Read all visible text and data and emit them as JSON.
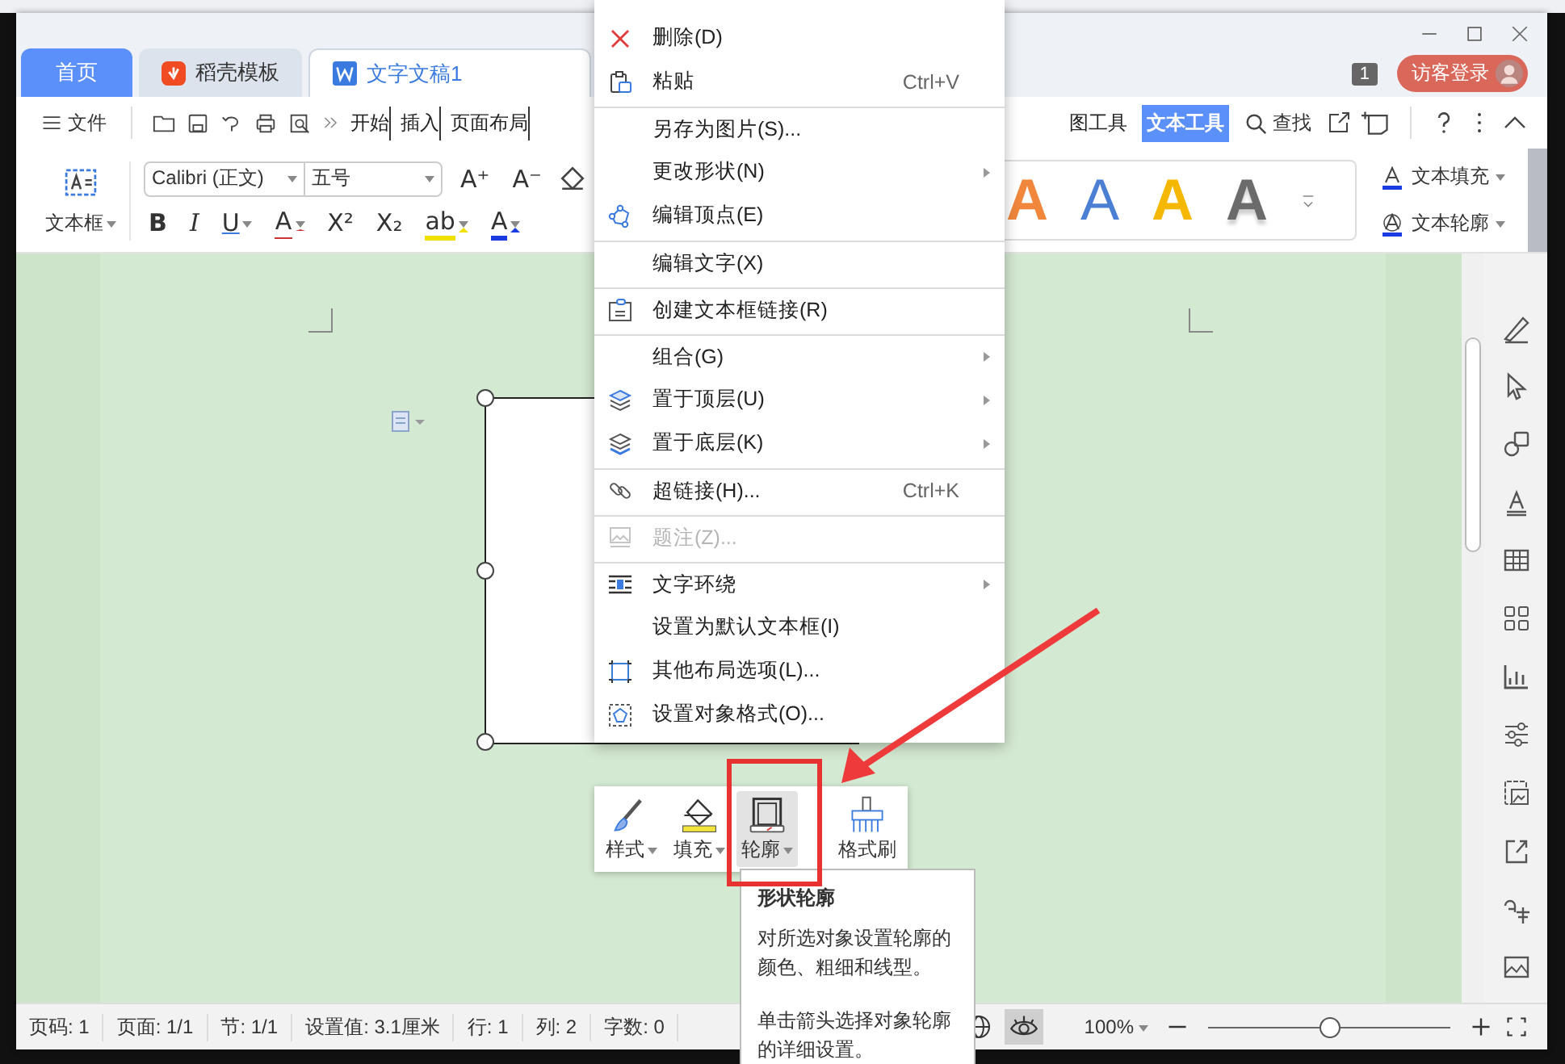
{
  "tabs": [
    {
      "label": "首页",
      "kind": "home",
      "selected": false
    },
    {
      "label": "稻壳模板",
      "kind": "docer",
      "selected": false
    },
    {
      "label": "文字文稿1",
      "kind": "document",
      "selected": true
    }
  ],
  "notification_count": "1",
  "login_button": "访客登录",
  "menu_bar": {
    "file": "文件",
    "ribbon_tabs": [
      {
        "label": "开始",
        "selected": false
      },
      {
        "label": "插入",
        "selected": false
      },
      {
        "label": "页面布局",
        "selected": false
      }
    ],
    "context_tabs": [
      {
        "label": "图工具",
        "selected": false
      },
      {
        "label": "文本工具",
        "selected": true
      }
    ],
    "search": "查找"
  },
  "ribbon": {
    "textbox": "文本框",
    "font": "Calibri (正文)",
    "font_size": "五号",
    "grow_font": "A⁺",
    "shrink_font": "A⁻",
    "format_buttons": [
      {
        "label": "B",
        "kind": "bold"
      },
      {
        "label": "I",
        "kind": "italic"
      },
      {
        "label": "U",
        "kind": "underline"
      },
      {
        "label": "A",
        "kind": "strike"
      },
      {
        "label": "X²",
        "kind": "plain"
      },
      {
        "label": "X₂",
        "kind": "plain"
      },
      {
        "label": "ab",
        "kind": "highlight"
      },
      {
        "label": "A",
        "kind": "font-color"
      }
    ],
    "art_styles": [
      {
        "label": "A",
        "color": "#f0873c",
        "kind": "filled"
      },
      {
        "label": "A",
        "color": "#4a7fd4",
        "kind": "outline"
      },
      {
        "label": "A",
        "color": "#f5b800",
        "kind": "filled"
      },
      {
        "label": "A",
        "color": "#6b6b6b",
        "kind": "gradient"
      }
    ],
    "text_fill": "文本填充",
    "text_outline": "文本轮廓"
  },
  "context_menu": {
    "items": [
      {
        "label": "删除(D)",
        "kind": "cross",
        "divider_before": false,
        "submenu": false,
        "disabled": false
      },
      {
        "label": "粘贴",
        "shortcut": "Ctrl+V",
        "kind": "clipboard",
        "divider_before": false,
        "submenu": false,
        "disabled": false
      },
      {
        "label": "另存为图片(S)...",
        "divider_before": true,
        "submenu": false,
        "disabled": false
      },
      {
        "label": "更改形状(N)",
        "divider_before": false,
        "submenu": true,
        "disabled": false
      },
      {
        "label": "编辑顶点(E)",
        "kind": "nodes",
        "divider_before": false,
        "submenu": false,
        "disabled": false
      },
      {
        "label": "编辑文字(X)",
        "divider_before": true,
        "submenu": false,
        "disabled": false
      },
      {
        "label": "创建文本框链接(R)",
        "kind": "linked-textbox",
        "divider_before": true,
        "submenu": false,
        "disabled": false
      },
      {
        "label": "组合(G)",
        "divider_before": true,
        "submenu": true,
        "disabled": false
      },
      {
        "label": "置于顶层(U)",
        "kind": "layers-top",
        "divider_before": false,
        "submenu": true,
        "disabled": false
      },
      {
        "label": "置于底层(K)",
        "kind": "layers-bottom",
        "divider_before": false,
        "submenu": true,
        "disabled": false
      },
      {
        "label": "超链接(H)...",
        "shortcut": "Ctrl+K",
        "kind": "chain",
        "divider_before": true,
        "submenu": false,
        "disabled": false
      },
      {
        "label": "题注(Z)...",
        "kind": "caption",
        "divider_before": true,
        "submenu": false,
        "disabled": true
      },
      {
        "label": "文字环绕",
        "kind": "wrap",
        "divider_before": true,
        "submenu": true,
        "disabled": false
      },
      {
        "label": "设置为默认文本框(I)",
        "divider_before": false,
        "submenu": false,
        "disabled": false
      },
      {
        "label": "其他布局选项(L)...",
        "kind": "frame",
        "divider_before": false,
        "submenu": false,
        "disabled": false
      },
      {
        "label": "设置对象格式(O)...",
        "kind": "format",
        "divider_before": false,
        "submenu": false,
        "disabled": false
      }
    ]
  },
  "float_toolbar": [
    {
      "label": "样式",
      "kind": "brush",
      "has_caret": true,
      "selected": false
    },
    {
      "label": "填充",
      "kind": "fill",
      "has_caret": true,
      "selected": false
    },
    {
      "label": "轮廓",
      "kind": "outline",
      "has_caret": true,
      "selected": true
    },
    {
      "label": "格式刷",
      "kind": "painter",
      "has_caret": false,
      "selected": false
    }
  ],
  "tooltip": {
    "title": "形状轮廓",
    "paragraphs": [
      "对所选对象设置轮廓的颜色、粗细和线型。",
      "单击箭头选择对象轮廓的详细设置。"
    ]
  },
  "status_bar": {
    "items": [
      "页码: 1",
      "页面: 1/1",
      "节: 1/1",
      "设置值: 3.1厘米",
      "行: 1",
      "列: 2",
      "字数: 0"
    ],
    "eye_protection": {
      "on": true
    },
    "zoom": "100%",
    "zoom_slider": {
      "level": 0.5
    }
  }
}
